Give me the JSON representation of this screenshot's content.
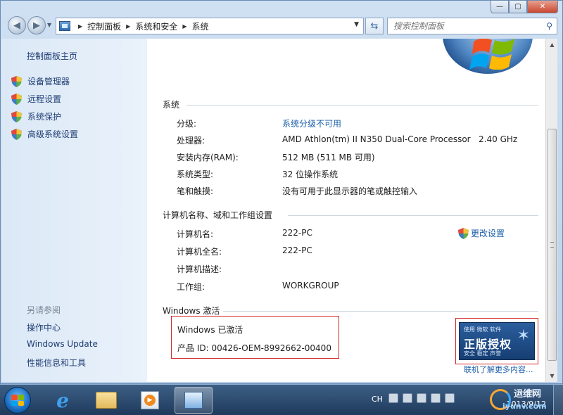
{
  "window": {
    "caption": {
      "minimize": "—",
      "maximize": "▢",
      "close": "✕"
    }
  },
  "navbar": {
    "breadcrumb": [
      "控制面板",
      "系统和安全",
      "系统"
    ],
    "search_placeholder": "搜索控制面板"
  },
  "left_pane": {
    "home": "控制面板主页",
    "links": [
      "设备管理器",
      "远程设置",
      "系统保护",
      "高级系统设置"
    ],
    "see_also_title": "另请参阅",
    "see_also": [
      "操作中心",
      "Windows Update",
      "性能信息和工具"
    ]
  },
  "system": {
    "title": "系统",
    "rows": [
      {
        "label": "分级:",
        "value": "系统分级不可用"
      },
      {
        "label": "处理器:",
        "value": "AMD Athlon(tm) II N350 Dual-Core Processor   2.40 GHz"
      },
      {
        "label": "安装内存(RAM):",
        "value": "512 MB (511 MB 可用)"
      },
      {
        "label": "系统类型:",
        "value": "32 位操作系统"
      },
      {
        "label": "笔和触摸:",
        "value": "没有可用于此显示器的笔或触控输入"
      }
    ]
  },
  "computer": {
    "title": "计算机名称、域和工作组设置",
    "change_settings": "更改设置",
    "rows": [
      {
        "label": "计算机名:",
        "value": "222-PC"
      },
      {
        "label": "计算机全名:",
        "value": "222-PC"
      },
      {
        "label": "计算机描述:",
        "value": ""
      },
      {
        "label": "工作组:",
        "value": "WORKGROUP"
      }
    ]
  },
  "activation": {
    "title": "Windows 激活",
    "status": "Windows 已激活",
    "product_id": "产品 ID: 00426-OEM-8992662-00400",
    "badge_top": "使用 微软 软件",
    "badge_main": "正版授权",
    "badge_sub": "安全 稳定 声誉",
    "learn_more": "联机了解更多内容..."
  },
  "taskbar": {
    "language": "CH",
    "time": "8:35",
    "date": "2013/9/12",
    "watermark_1": "运维网",
    "watermark_2": "iyunv.com"
  },
  "colors": {
    "link": "#1a5ea8",
    "highlight_border": "#d22a2a",
    "left_pane_bg": "#dbe8f6"
  }
}
